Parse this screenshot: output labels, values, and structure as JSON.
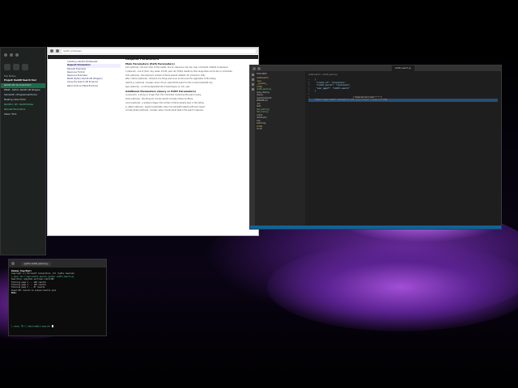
{
  "notes": {
    "section_label": "Top Notes",
    "items": [
      {
        "label": "Project: Reddit Search Tool",
        "style": "head"
      },
      {
        "label": "Reddit API documentation",
        "style": "active"
      },
      {
        "label": "PRAW - Python Reddit API Wrapper",
        "style": "normal"
      },
      {
        "label": "Subreddit: r/ProgrammerHumor",
        "style": "normal"
      },
      {
        "label": "Meeting notes 03/12",
        "style": "normal"
      },
      {
        "label": "Redditor: API - Reddit Notes",
        "style": "green"
      },
      {
        "label": "Request Parameters",
        "style": "green"
      },
      {
        "label": "Ideas / Todo",
        "style": "normal"
      }
    ]
  },
  "browser": {
    "url": "reddit.com/dev/api",
    "toc": [
      "Introduction",
      "Creating a Reddit API Request",
      "Request Parameters",
      "Request Examples",
      "Response Format",
      "Response Examples",
      "PRAW (Python Reddit API Wrapper)",
      "Using the Search API Endpoint",
      "Rate Limits and Best Practices"
    ],
    "toc_selected_index": 2,
    "heading": "Request Parameters",
    "subheading1": "Main Parameters (Path Parameters)",
    "paragraphs1": [
      "sort (optional) - the sort order of the results. One of: relevance, hot, top, new, comments. Default is relevance.",
      "t (optional) - one of (hour, day, week, month, year, all). Filters results by time range when sort is top or comments.",
      "limit (optional) - the maximum number of items desired (default: 25, maximum: 100).",
      "after / before (optional) - fullname of a thing used as an anchor point for pagination of the listing.",
      "restrict_sr (optional) - boolean value; if true, restricts the search to the current subreddit only.",
      "type (optional) - a comma-separated list of result types: sr, link, user."
    ],
    "subheading2": "Additional Parameters (Query or POST Parameters)",
    "paragraphs2": [
      "q (required) - a string no longer than 512 characters containing the search query.",
      "show (optional) - the string all; include results normally hidden by filters.",
      "count (optional) - a positive integer; the number of items already seen in this listing.",
      "sr_detail (optional) - expand subreddits; return full subreddit objects with each result.",
      "include_facets (optional) - boolean value; include facet data in the search response."
    ]
  },
  "vscode": {
    "tab_label": "reddit_search.py",
    "explorer_title": "EXPLORER",
    "files": [
      {
        "name": "reddit-search",
        "kind": "folder"
      },
      {
        "name": ".venv",
        "kind": "folder"
      },
      {
        "name": "__pycache__",
        "kind": "folder"
      },
      {
        "name": "config",
        "kind": "folder"
      },
      {
        "name": "reddit_search.py",
        "kind": "mod"
      },
      {
        "name": "praw_client.py",
        "kind": "file"
      },
      {
        "name": "utils.py",
        "kind": "file"
      },
      {
        "name": "requirements.txt",
        "kind": "file"
      },
      {
        "name": "README.md",
        "kind": "file"
      },
      {
        "name": ".env",
        "kind": "file"
      },
      {
        "name": "tests",
        "kind": "folder"
      },
      {
        "name": "test_search.py",
        "kind": "mod"
      },
      {
        "name": "test_client.py",
        "kind": "mod"
      },
      {
        "name": "output",
        "kind": "folder"
      },
      {
        "name": "results.json",
        "kind": "file"
      },
      {
        "name": "logs",
        "kind": "folder"
      },
      {
        "name": "search.log",
        "kind": "file"
      },
      {
        "name": "scripts",
        "kind": "folder"
      },
      {
        "name": "run.sh",
        "kind": "file"
      }
    ],
    "breadcrumb": "reddit-search > reddit_search.py",
    "code_lines": [
      {
        "n": "1",
        "text": "{"
      },
      {
        "n": "2",
        "text": "  \"client_id\": \"xxxxxxxxxx\","
      },
      {
        "n": "3",
        "text": "  \"client_secret\": \"xxxxxxxxxx\","
      },
      {
        "n": "4",
        "text": "  \"user_agent\": \"reddit-search\""
      },
      {
        "n": "5",
        "text": "}"
      },
      {
        "n": "6",
        "text": ""
      },
      {
        "n": "7",
        "text": ""
      },
      {
        "n": "8",
        "text": "https://www.reddit.com/search.json?q=python&sort=new&limit=100"
      }
    ],
    "highlight_line": 7,
    "tooltip": "Follow link (ctrl + click)"
  },
  "terminal": {
    "tab_label": "python reddit_search.py",
    "lines": [
      {
        "text": "Windows PowerShell",
        "style": "b"
      },
      {
        "text": "Copyright (C) Microsoft Corporation. All rights reserved.",
        "style": "n"
      },
      {
        "text": "",
        "style": "n"
      },
      {
        "text": "(.venv) PS C:\\dev\\reddit-search> python reddit_search.py",
        "style": "g"
      },
      {
        "text": "Searching: q=python sort=new limit=100",
        "style": "n"
      },
      {
        "text": "Fetching page 1 ... 100 results",
        "style": "n"
      },
      {
        "text": "Fetching page 2 ... 100 results",
        "style": "n"
      },
      {
        "text": "Fetching page 3 ... 87 results",
        "style": "n"
      },
      {
        "text": "Saved 287 results to output/results.json",
        "style": "n"
      },
      {
        "text": "",
        "style": "n"
      },
      {
        "text": "Done.",
        "style": "b"
      }
    ],
    "prompt": "(.venv) PS C:\\dev\\reddit-search>"
  }
}
